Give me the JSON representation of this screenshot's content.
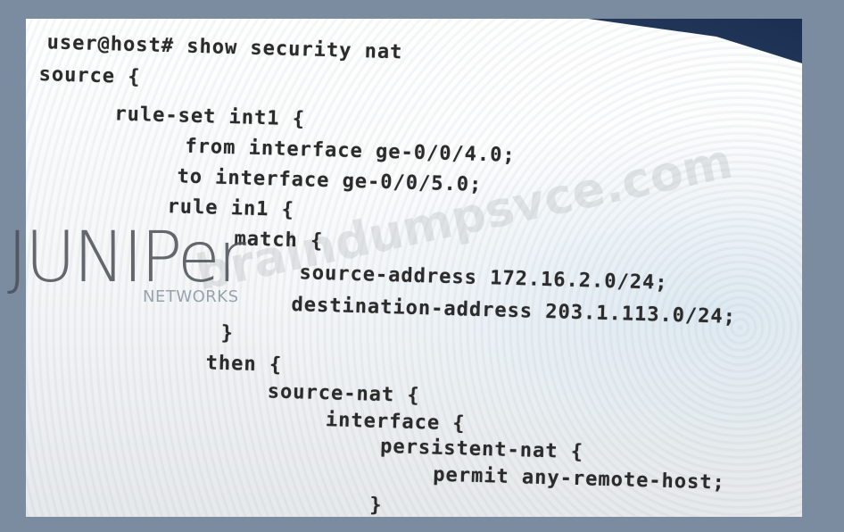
{
  "code_lines": [
    "user@host# show security nat",
    "source {",
    "rule-set int1 {",
    "from interface ge-0/0/4.0;",
    "to interface ge-0/0/5.0;",
    "rule in1 {",
    "match {",
    "source-address 172.16.2.0/24;",
    "destination-address 203.1.113.0/24;",
    "}",
    "then {",
    "source-nat {",
    "interface {",
    "persistent-nat {",
    "permit any-remote-host;",
    "}"
  ],
  "watermark": {
    "logo_text": "JUNIPer",
    "logo_sub": "NETWORKS",
    "site": "braindumpsvce.com"
  }
}
